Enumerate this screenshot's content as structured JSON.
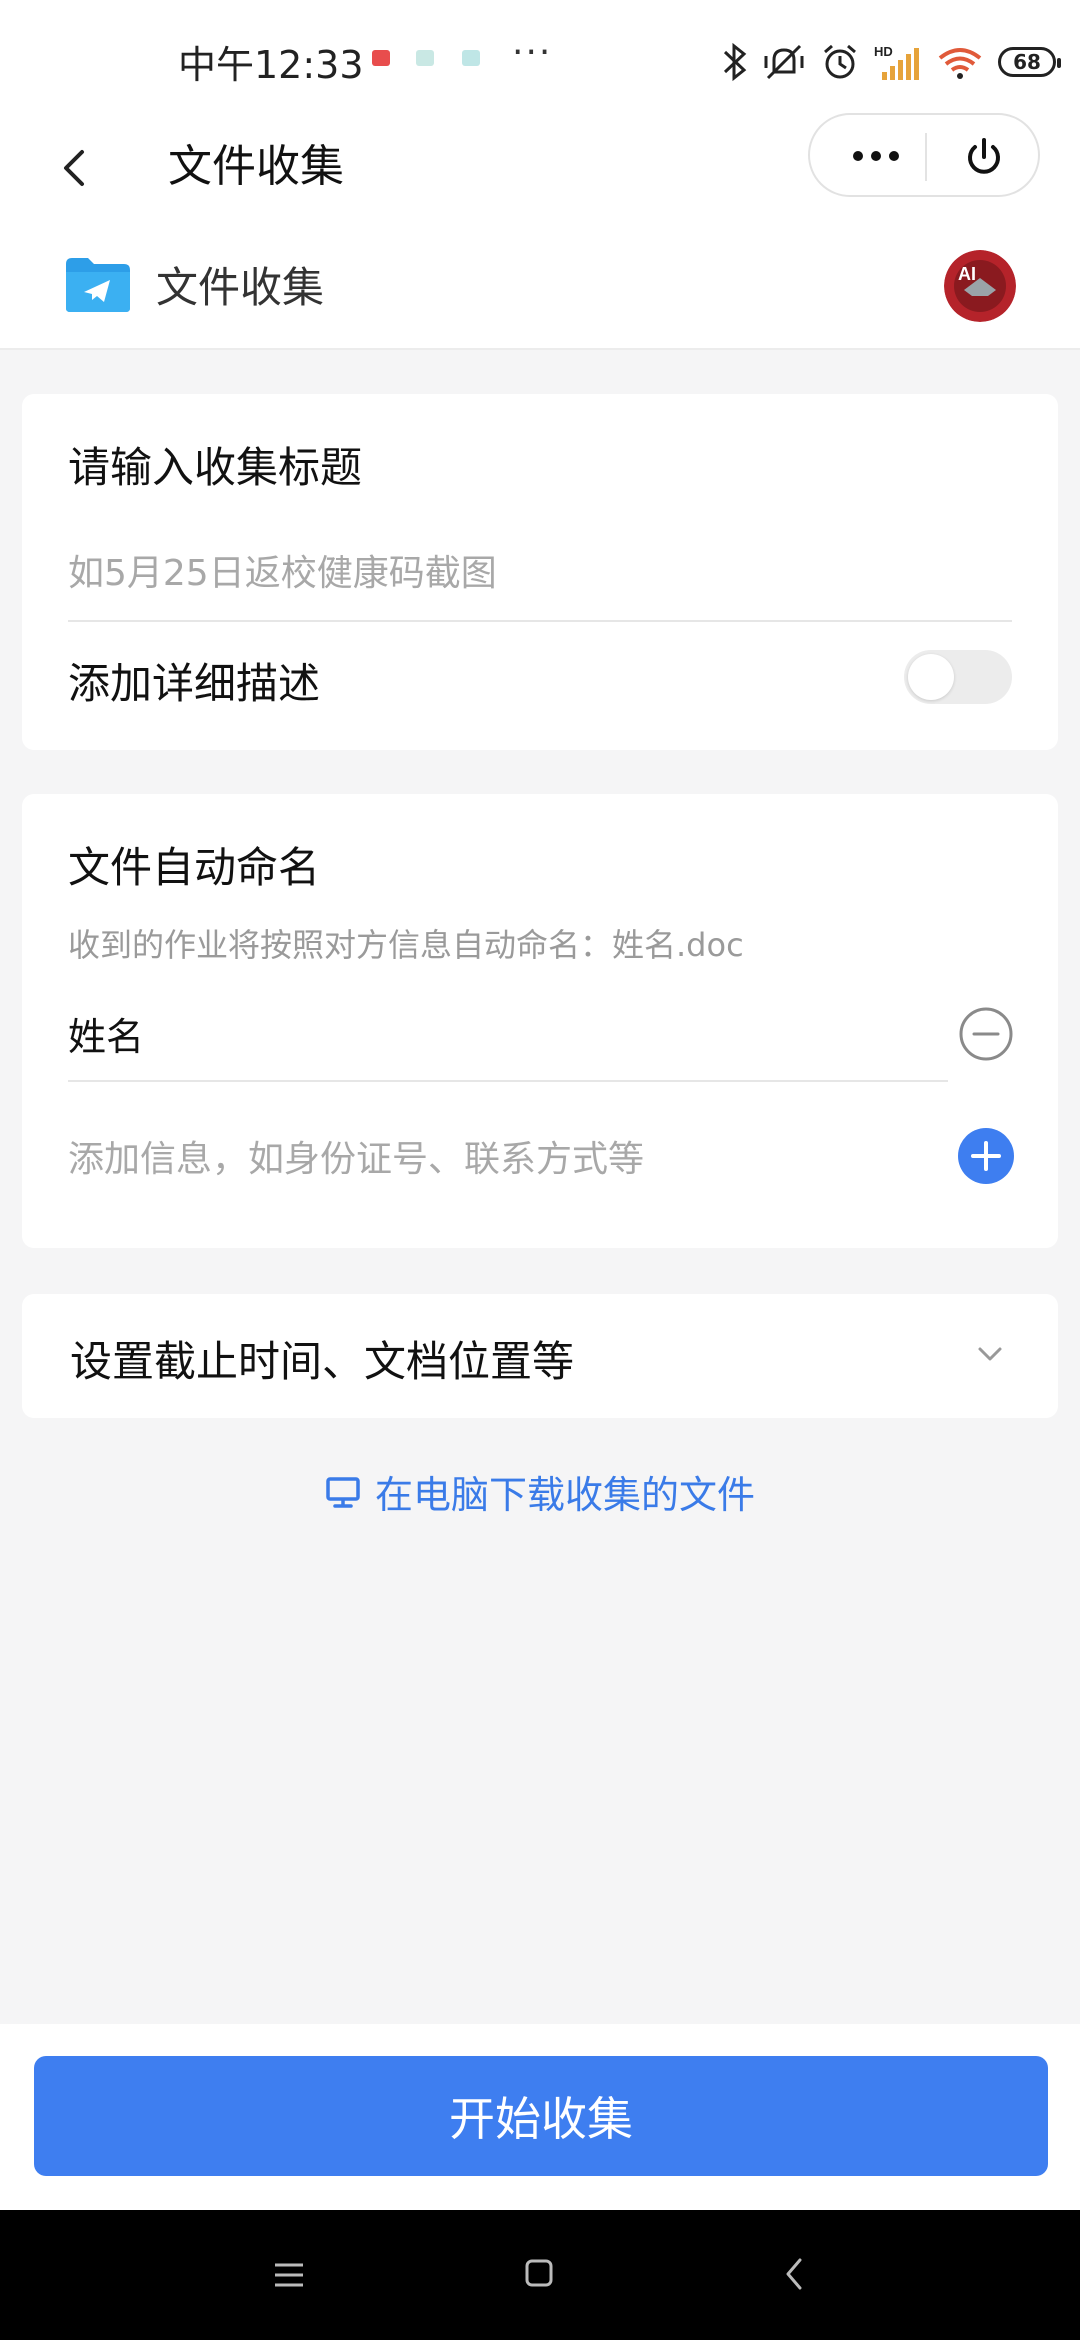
{
  "status_bar": {
    "time": "中午12:33",
    "overflow": "···",
    "battery": "68",
    "icons": [
      "bluetooth-icon",
      "mute-vibrate-icon",
      "alarm-icon",
      "hd-signal-icon",
      "wifi-icon",
      "battery-icon"
    ]
  },
  "nav": {
    "title": "文件收集",
    "back_icon": "chevron-left-icon",
    "more_icon": "more-dots-icon",
    "power_icon": "power-icon"
  },
  "app_header": {
    "name": "文件收集",
    "logo_icon": "folder-send-icon",
    "avatar_text": "AI"
  },
  "card1": {
    "title_label": "请输入收集标题",
    "title_placeholder": "如5月25日返校健康码截图",
    "description_label": "添加详细描述",
    "description_toggle_on": false
  },
  "card2": {
    "heading": "文件自动命名",
    "hint": "收到的作业将按照对方信息自动命名：姓名.doc",
    "field_value": "姓名",
    "add_placeholder": "添加信息，如身份证号、联系方式等"
  },
  "card3": {
    "label": "设置截止时间、文档位置等"
  },
  "download_link": {
    "text": "在电脑下载收集的文件",
    "icon": "monitor-icon"
  },
  "start_button": {
    "label": "开始收集"
  },
  "colors": {
    "accent": "#3e7ef0",
    "link": "#3a7be8",
    "background": "#f5f5f6"
  }
}
